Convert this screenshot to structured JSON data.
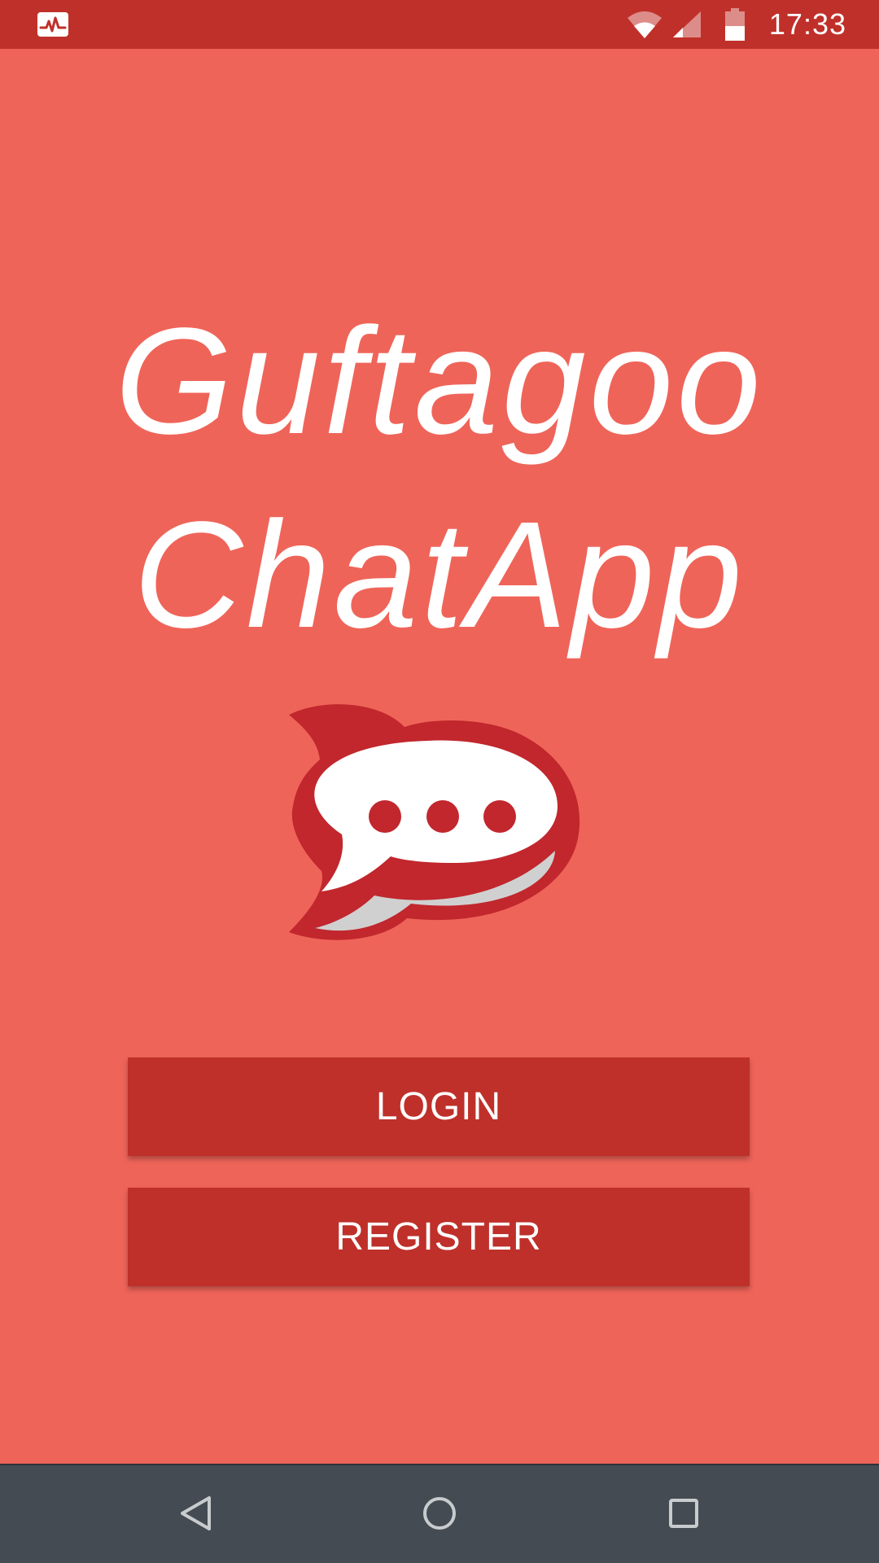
{
  "status_bar": {
    "time": "17:33",
    "app_icon": "pulse-monitor-icon",
    "wifi_icon": "wifi-icon",
    "signal_icon": "cell-signal-icon",
    "battery_icon": "battery-icon",
    "color": "#C0302A"
  },
  "title": {
    "line1": "Guftagoo",
    "line2": "ChatApp"
  },
  "logo": {
    "icon": "chat-bubble-logo-icon"
  },
  "buttons": {
    "login_label": "LOGIN",
    "register_label": "REGISTER"
  },
  "nav_bar": {
    "back_icon": "back-triangle-icon",
    "home_icon": "home-circle-icon",
    "recents_icon": "recents-square-icon"
  },
  "colors": {
    "background": "#EF6459",
    "accent": "#BF302A",
    "logo_red": "#C1272D",
    "nav_bar": "#454B52"
  }
}
